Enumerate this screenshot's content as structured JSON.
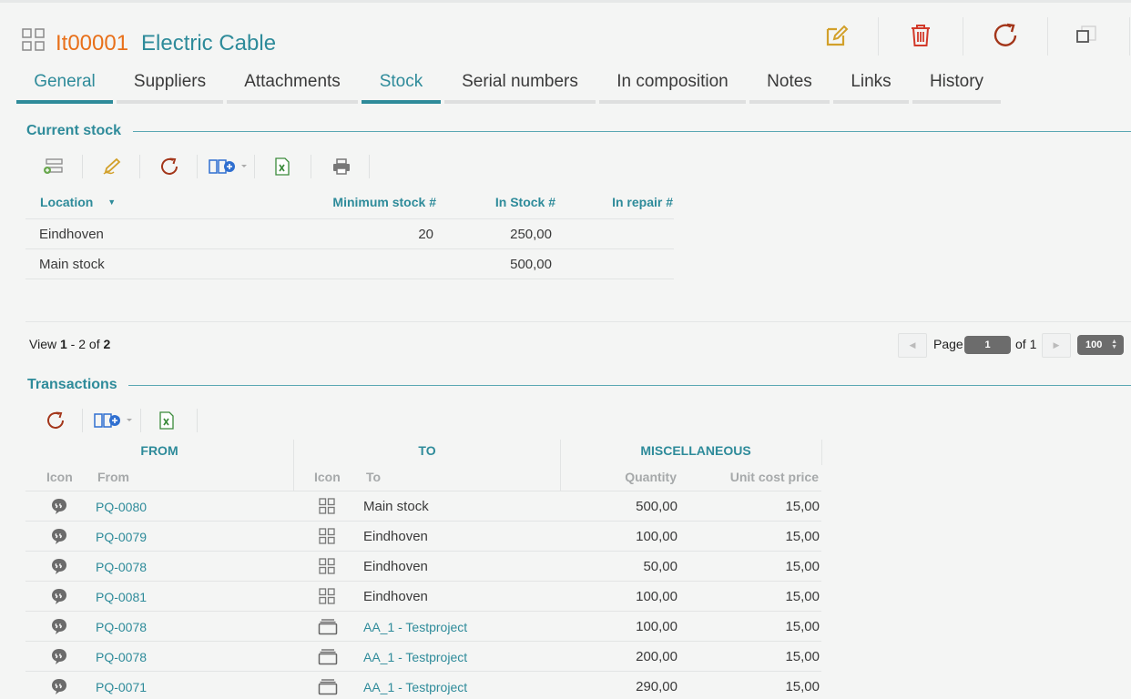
{
  "header": {
    "code": "It00001",
    "name": "Electric Cable",
    "actions": [
      {
        "name": "edit-icon",
        "color": "#d2a02a"
      },
      {
        "name": "trash-icon",
        "color": "#d23a2a"
      },
      {
        "name": "refresh-icon",
        "color": "#a3361a"
      },
      {
        "name": "restore-window-icon",
        "color": "#555555"
      }
    ]
  },
  "tabs": [
    {
      "label": "General",
      "active": true
    },
    {
      "label": "Suppliers",
      "active": false
    },
    {
      "label": "Attachments",
      "active": false
    },
    {
      "label": "Stock",
      "active": true
    },
    {
      "label": "Serial numbers",
      "active": false
    },
    {
      "label": "In composition",
      "active": false
    },
    {
      "label": "Notes",
      "active": false
    },
    {
      "label": "Links",
      "active": false
    },
    {
      "label": "History",
      "active": false
    }
  ],
  "current_stock": {
    "title": "Current stock",
    "toolbar": [
      "add-row-icon",
      "edit-pencil-icon",
      "refresh-icon",
      "columns-add-icon",
      "excel-icon",
      "print-icon"
    ],
    "columns": {
      "location": "Location",
      "minimum": "Minimum stock #",
      "in_stock": "In Stock #",
      "in_repair": "In repair #"
    },
    "rows": [
      {
        "location": "Eindhoven",
        "minimum": "20",
        "in_stock": "250,00",
        "in_repair": ""
      },
      {
        "location": "Main stock",
        "minimum": "",
        "in_stock": "500,00",
        "in_repair": ""
      }
    ],
    "view": {
      "prefix": "View",
      "start": "1",
      "dash": "-",
      "end": "2",
      "of": "of",
      "total": "2"
    },
    "pager": {
      "page_label": "Page",
      "page": "1",
      "of_label": "of 1",
      "page_size": "100"
    }
  },
  "transactions": {
    "title": "Transactions",
    "toolbar": [
      "refresh-icon",
      "columns-add-icon",
      "excel-icon"
    ],
    "groups": {
      "from": "FROM",
      "to": "TO",
      "misc": "MISCELLANEOUS"
    },
    "columns": {
      "from_icon": "Icon",
      "from": "From",
      "to_icon": "Icon",
      "to": "To",
      "quantity": "Quantity",
      "unit_cost": "Unit cost price"
    },
    "rows": [
      {
        "from_icon": "speech-bubble-icon",
        "from": "PQ-0080",
        "to_icon": "grid-icon",
        "to": "Main stock",
        "to_link": false,
        "quantity": "500,00",
        "unit_cost": "15,00"
      },
      {
        "from_icon": "speech-bubble-icon",
        "from": "PQ-0079",
        "to_icon": "grid-icon",
        "to": "Eindhoven",
        "to_link": false,
        "quantity": "100,00",
        "unit_cost": "15,00"
      },
      {
        "from_icon": "speech-bubble-icon",
        "from": "PQ-0078",
        "to_icon": "grid-icon",
        "to": "Eindhoven",
        "to_link": false,
        "quantity": "50,00",
        "unit_cost": "15,00"
      },
      {
        "from_icon": "speech-bubble-icon",
        "from": "PQ-0081",
        "to_icon": "grid-icon",
        "to": "Eindhoven",
        "to_link": false,
        "quantity": "100,00",
        "unit_cost": "15,00"
      },
      {
        "from_icon": "speech-bubble-icon",
        "from": "PQ-0078",
        "to_icon": "project-stack-icon",
        "to": "AA_1 - Testproject",
        "to_link": true,
        "quantity": "100,00",
        "unit_cost": "15,00"
      },
      {
        "from_icon": "speech-bubble-icon",
        "from": "PQ-0078",
        "to_icon": "project-stack-icon",
        "to": "AA_1 - Testproject",
        "to_link": true,
        "quantity": "200,00",
        "unit_cost": "15,00"
      },
      {
        "from_icon": "speech-bubble-icon",
        "from": "PQ-0071",
        "to_icon": "project-stack-icon",
        "to": "AA_1 - Testproject",
        "to_link": true,
        "quantity": "290,00",
        "unit_cost": "15,00"
      }
    ]
  },
  "colors": {
    "accent": "#2e8b9a",
    "code": "#e8701a",
    "background": "#f4f5f4"
  }
}
